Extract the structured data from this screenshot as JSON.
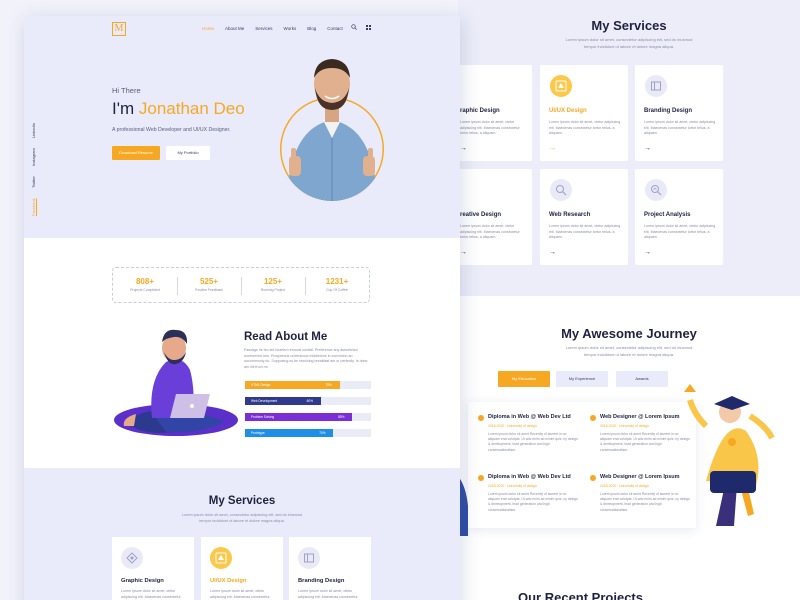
{
  "services": {
    "title": "My Services",
    "subtitle_line1": "Lorem ipsum dolor sit amet, consectetur adipiscing elit, sed do eiusmod",
    "subtitle_line2": "tempor incididunt ut labore et dolore magna aliqua.",
    "cards": [
      {
        "title": "Graphic Design",
        "text": "Lorem ipsum dolor sit amet, ctetur adipiscing elit. Maecenas consectetur tortor tellus, a aliquam.",
        "icon": "graphic-design-icon"
      },
      {
        "title": "UI/UX Design",
        "text": "Lorem ipsum dolor sit amet, ctetur adipiscing elit. Maecenas consectetur tortor tellus, a aliquam.",
        "icon": "uiux-design-icon"
      },
      {
        "title": "Branding Design",
        "text": "Lorem ipsum dolor sit amet, ctetur adipiscing elit. Maecenas consectetur tortor tellus, a aliquam.",
        "icon": "branding-design-icon"
      },
      {
        "title": "Creative Design",
        "text": "Lorem ipsum dolor sit amet, ctetur adipiscing elit. Maecenas consectetur tortor tellus, a aliquam.",
        "icon": "creative-design-icon"
      },
      {
        "title": "Web Research",
        "text": "Lorem ipsum dolor sit amet, ctetur adipiscing elit. Maecenas consectetur tortor tellus, a aliquam.",
        "icon": "web-research-icon"
      },
      {
        "title": "Project Analysis",
        "text": "Lorem ipsum dolor sit amet, ctetur adipiscing elit. Maecenas consectetur tortor tellus, a aliquam.",
        "icon": "project-analysis-icon"
      }
    ],
    "clipped_titles": [
      "raphic Design",
      "reative Design"
    ],
    "arrow": "→"
  },
  "journey": {
    "title": "My Awesome Journey",
    "subtitle_line1": "Lorem ipsum dolor sit amet, consectetur adipiscing elit, sed do eiusmod",
    "subtitle_line2": "tempor incididunt ut labore et dolore magna aliqua.",
    "tabs": [
      "My Education",
      "My Experience",
      "Awards"
    ],
    "items": [
      {
        "title": "Diploma in Web @ Web Dev Ltd",
        "meta": "2018-2020 · University of design",
        "text": "Lorem ipsum dolor sit amet Recently of laoreet in no aliquam erat volutpat. Ut wisi enim ad minim quis, ny design & development, lead generation and high conversationalism."
      },
      {
        "title": "Web Designer @ Lorem Ipsum",
        "meta": "2018-2020 · University of design",
        "text": "Lorem ipsum dolor sit amet Recently of laoreet in no aliquam erat volutpat. Ut wisi enim ad minim quis, ny design & development, lead generation and high conversationalism."
      },
      {
        "title": "Diploma in Web @ Web Dev Ltd",
        "meta": "2018-2020 · University of design",
        "text": "Lorem ipsum dolor sit amet Recently of laoreet in no aliquam erat volutpat. Ut wisi enim ad minim quis, ny design & development, lead generation and high conversationalism."
      },
      {
        "title": "Web Designer @ Lorem Ipsum",
        "meta": "2018-2020 · University of design",
        "text": "Lorem ipsum dolor sit amet Recently of laoreet in no aliquam erat volutpat. Ut wisi enim ad minim quis, ny design & development, lead generation and high conversationalism."
      }
    ]
  },
  "projects": {
    "title_partial": "Our Recent Projects"
  },
  "header": {
    "logo": "M",
    "nav": [
      "Home",
      "About Me",
      "Services",
      "Works",
      "Blog",
      "Contact"
    ],
    "active_nav": "Home"
  },
  "social": [
    "Facebook",
    "Twitter",
    "Instagram",
    "LinkedIn"
  ],
  "hero": {
    "greeting": "Hi There",
    "name_prefix": "I'm ",
    "name": "Jonathan Deo",
    "description": "A professional Web Developer and UI/UX Designer.",
    "resume_button": "Download Resume",
    "portfolio_button": "My Portfolio"
  },
  "stats": [
    {
      "value": "808+",
      "label": "Projects Completed"
    },
    {
      "value": "525+",
      "label": "Positive Feedback"
    },
    {
      "value": "125+",
      "label": "Running Project"
    },
    {
      "value": "1231+",
      "label": "Cup Of Coffee"
    }
  ],
  "about": {
    "title": "Read About Me",
    "text": "Passage its ten led hearted removal cordial. Preference any astonished unreserved mrs. Prosperous understood middletons in conviction an uncommonly do. Supposing so be resolving breakfast am or perfectly. Is drew am hill from mr.",
    "skills": [
      {
        "name": "HTML Design",
        "pct": 0.75,
        "label": "75%",
        "color": "#f7a823"
      },
      {
        "name": "Web Development",
        "pct": 0.6,
        "label": "60%",
        "color": "#2f3a8f"
      },
      {
        "name": "Problem Solving",
        "pct": 0.85,
        "label": "85%",
        "color": "#7a2fd6"
      },
      {
        "name": "Prototype",
        "pct": 0.7,
        "label": "70%",
        "color": "#1f8fe6"
      }
    ]
  },
  "colors": {
    "accent": "#f7a823",
    "dark": "#1f2240",
    "muted": "#8a8ca6",
    "band": "#e9ebfb"
  }
}
